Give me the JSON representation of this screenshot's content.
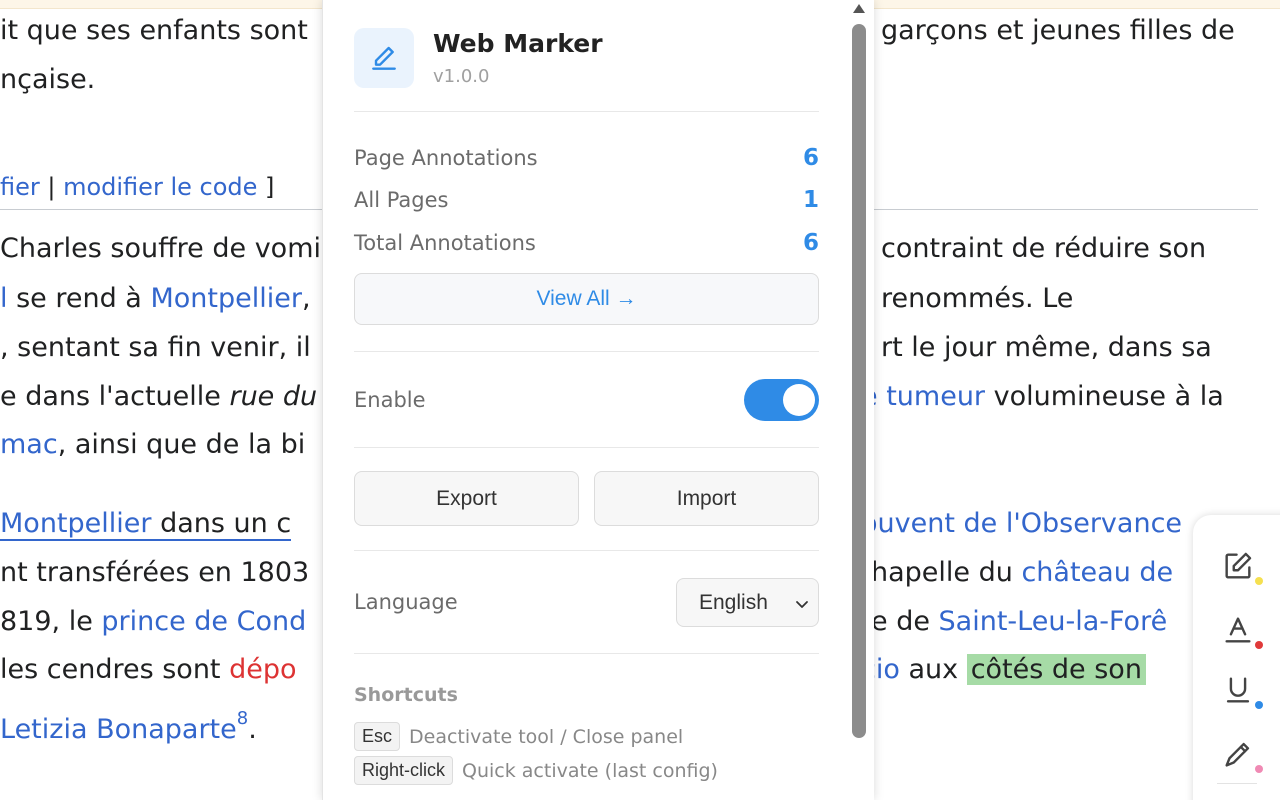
{
  "article": {
    "line1a": "it que ses enfants sont",
    "line1b": "garçons et jeunes filles de",
    "line2": "nçaise.",
    "edit_link1": "fier",
    "edit_sep": " | ",
    "edit_link2": "modifier le code",
    "edit_close": " ]",
    "line3a": "Charles souffre de vomi",
    "line3b": "contraint de réduire son",
    "line4a_link": "l",
    "line4a_text": " se rend à ",
    "line4a_link2": "Montpellier",
    "line4a_comma": ",",
    "line4b": "renommés. Le",
    "line5a": ", sentant sa fin venir, il",
    "line5b": "rt le jour même, dans sa",
    "line6a": "e dans l'actuelle ",
    "line6a_italic": "rue du",
    "line6b_pre": "e ",
    "line6b_link": "tumeur",
    "line6b_text": " volumineuse à la",
    "line7a_link": "mac",
    "line7a_text": ", ainsi que de la bi",
    "line8a_link": " Montpellier",
    "line8a_text": " dans un c",
    "line8b": "ouvent de l'Observance",
    "line9a": "nt transférées en 1803",
    "line9b_text": "hapelle du ",
    "line9b_link": "château de",
    "line10a_pre": "819, le ",
    "line10a_link": "prince de Cond",
    "line10b_text": "e de ",
    "line10b_link": "Saint-Leu-la-Forê",
    "line11a_text": " les cendres sont ",
    "line11a_red": "dépo",
    "line11b_link": "cio",
    "line11b_text": " aux ",
    "line11b_highlight": "côtés de son",
    "line12_link": "Letizia Bonaparte",
    "line12_sup": "8",
    "line12_end": "."
  },
  "panel": {
    "app_name": "Web Marker",
    "version": "v1.0.0",
    "stats": [
      {
        "label": "Page Annotations",
        "value": "6"
      },
      {
        "label": "All Pages",
        "value": "1"
      },
      {
        "label": "Total Annotations",
        "value": "6"
      }
    ],
    "view_all_label": "View All →",
    "enable_label": "Enable",
    "enabled": true,
    "export_label": "Export",
    "import_label": "Import",
    "language_label": "Language",
    "language_value": "English",
    "shortcuts_title": "Shortcuts",
    "shortcuts": [
      {
        "key": "Esc",
        "desc": "Deactivate tool / Close panel"
      },
      {
        "key": "Right-click",
        "desc": "Quick activate (last config)"
      }
    ],
    "accent_color": "#2f8be6"
  },
  "toolbar": {
    "tools": [
      {
        "icon": "edit-note-icon",
        "dot_color": "#f5e050"
      },
      {
        "icon": "text-highlight-icon",
        "dot_color": "#e03a3a"
      },
      {
        "icon": "underline-icon",
        "dot_color": "#2f8be6"
      },
      {
        "icon": "pen-icon",
        "dot_color": "#f08ab4"
      }
    ]
  }
}
